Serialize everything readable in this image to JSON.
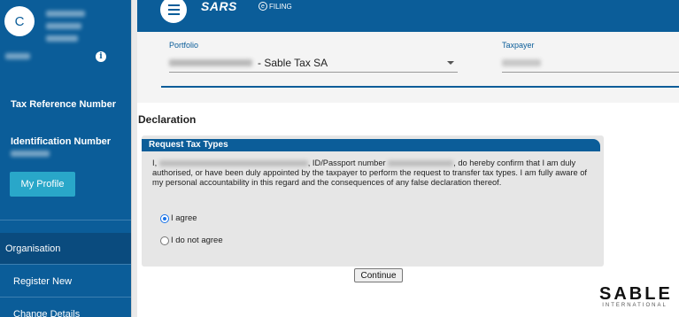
{
  "sidebar": {
    "avatar_initial": "C",
    "tax_reference_label": "Tax Reference Number",
    "identification_label": "Identification Number",
    "my_profile_label": "My Profile",
    "info_icon": "i",
    "nav": {
      "organisation": "Organisation",
      "register_new": "Register New",
      "change_details": "Change Details"
    }
  },
  "header": {
    "brand": "SARS",
    "efiling": "FILING"
  },
  "portfolio": {
    "portfolio_label": "Portfolio",
    "portfolio_value": "- Sable Tax SA",
    "taxpayer_label": "Taxpayer"
  },
  "declaration": {
    "title": "Declaration",
    "panel_title": "Request Tax Types",
    "text_part1": "I,",
    "text_part2": ", ID/Passport number",
    "text_part3": ", do hereby confirm that I am duly authorised, or have been duly appointed by the taxpayer to perform the request to transfer tax types. I am fully aware of my personal accountability in this regard and the consequences of any false declaration thereof.",
    "agree_label": "I agree",
    "disagree_label": "I do not agree",
    "continue_label": "Continue"
  },
  "logo": {
    "word": "SABLE",
    "sub": "INTERNATIONAL"
  },
  "colors": {
    "primary": "#0b5d99",
    "button_accent": "#29a7c9",
    "panel_bg": "#e6e6e6"
  }
}
